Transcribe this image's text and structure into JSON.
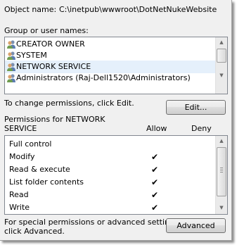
{
  "object": {
    "label": "Object name:",
    "value": "C:\\inetpub\\wwwroot\\DotNetNukeWebsite"
  },
  "groups": {
    "label": "Group or user names:",
    "items": [
      {
        "name": "CREATOR OWNER",
        "selected": false
      },
      {
        "name": "SYSTEM",
        "selected": false
      },
      {
        "name": "NETWORK SERVICE",
        "selected": true
      },
      {
        "name": "Administrators (Raj-Dell1520\\Administrators)",
        "selected": false
      }
    ]
  },
  "change": {
    "text": "To change permissions, click Edit.",
    "edit_button": "Edit..."
  },
  "permissions": {
    "title_line1": "Permissions for NETWORK",
    "title_line2": "SERVICE",
    "allow_header": "Allow",
    "deny_header": "Deny",
    "rows": [
      {
        "name": "Full control",
        "allow": false,
        "deny": false
      },
      {
        "name": "Modify",
        "allow": true,
        "deny": false
      },
      {
        "name": "Read & execute",
        "allow": true,
        "deny": false
      },
      {
        "name": "List folder contents",
        "allow": true,
        "deny": false
      },
      {
        "name": "Read",
        "allow": true,
        "deny": false
      },
      {
        "name": "Write",
        "allow": true,
        "deny": false
      }
    ],
    "check_glyph": "✔"
  },
  "special": {
    "line1": "For special permissions or advanced settings,",
    "line2": "click Advanced.",
    "advanced_button": "Advanced"
  },
  "colors": {
    "dialog_bg": "#f0f0f0",
    "selected_row": "#e5f0fb"
  }
}
